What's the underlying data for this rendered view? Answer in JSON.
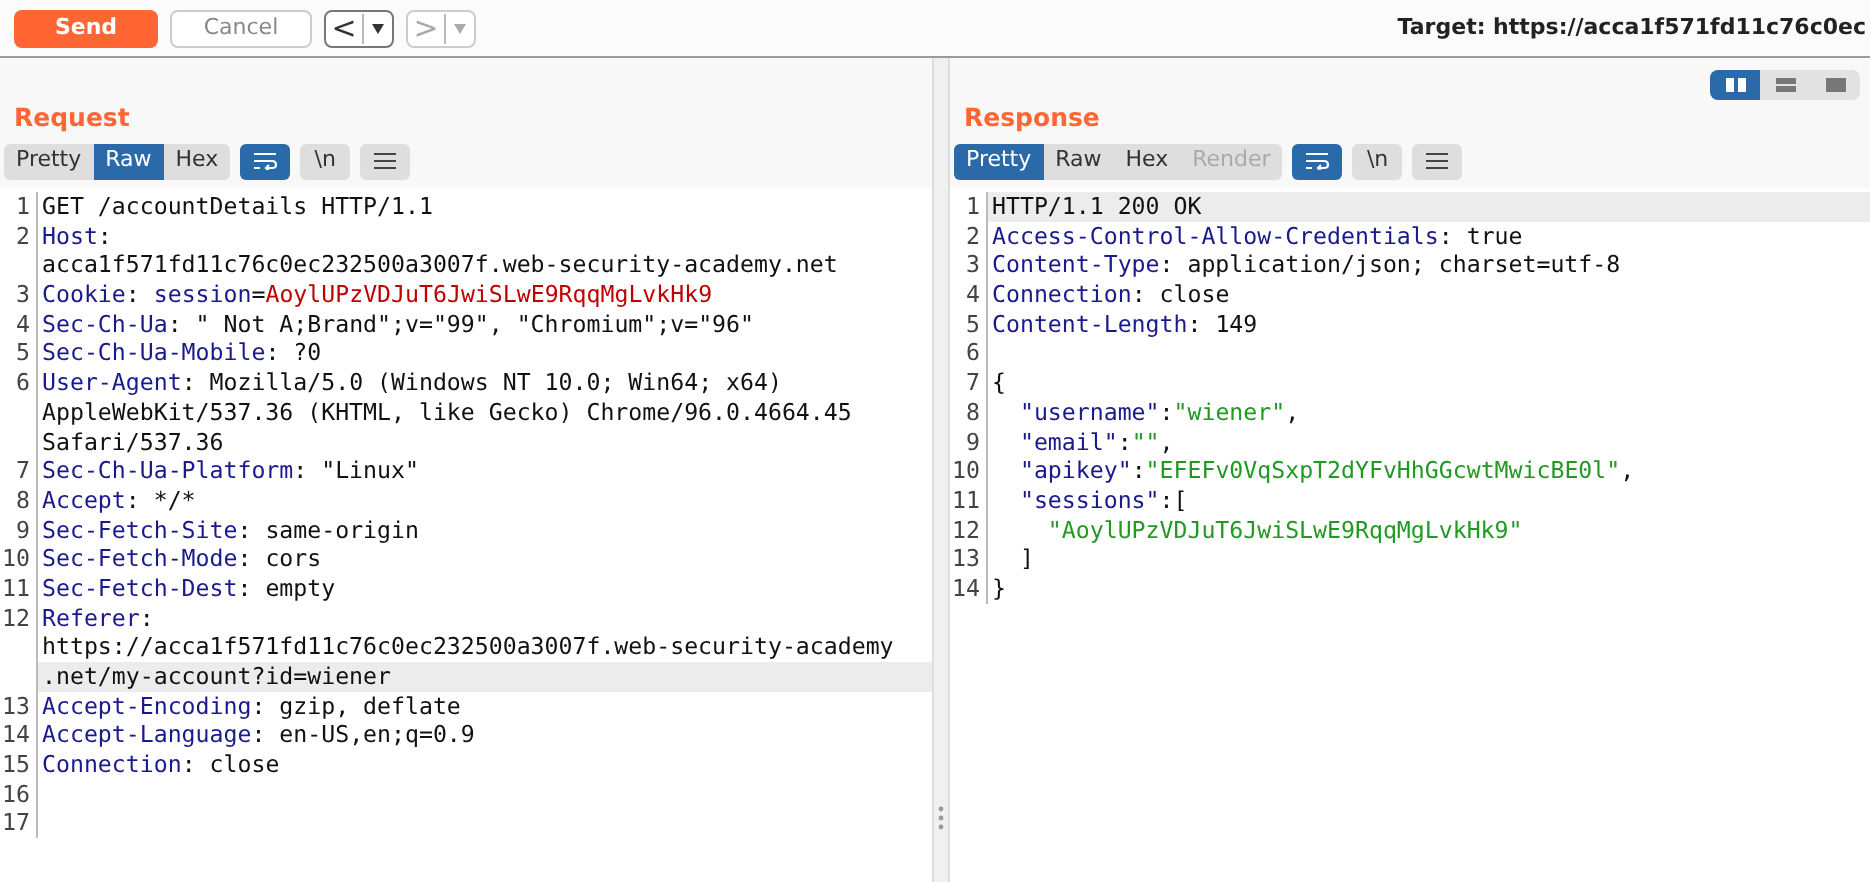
{
  "toolbar": {
    "send": "Send",
    "cancel": "Cancel",
    "back": {
      "label": "<",
      "disabled": false
    },
    "forward": {
      "label": ">",
      "disabled": true
    },
    "target": "Target: https://acca1f571fd11c76c0ec"
  },
  "layout_buttons": [
    {
      "kind": "split",
      "selected": true
    },
    {
      "kind": "stacked",
      "selected": false
    },
    {
      "kind": "single",
      "selected": false
    }
  ],
  "request": {
    "title": "Request",
    "tabs": [
      {
        "label": "Pretty",
        "selected": false,
        "disabled": false
      },
      {
        "label": "Raw",
        "selected": true,
        "disabled": false
      },
      {
        "label": "Hex",
        "selected": false,
        "disabled": false
      }
    ],
    "toggles": [
      {
        "kind": "wrap",
        "on": true
      },
      {
        "kind": "newline",
        "label": "\\n",
        "on": false
      },
      {
        "kind": "menu"
      }
    ],
    "lines": [
      {
        "number": "1",
        "rows": [
          {
            "highlighted": false,
            "segments": [
              {
                "kind": "plain",
                "text": "GET /accountDetails HTTP/1.1"
              }
            ]
          }
        ]
      },
      {
        "number": "2",
        "rows": [
          {
            "highlighted": false,
            "segments": [
              {
                "kind": "name",
                "text": "Host"
              },
              {
                "kind": "plain",
                "text": ":"
              }
            ]
          },
          {
            "highlighted": false,
            "segments": [
              {
                "kind": "plain",
                "text": "acca1f571fd11c76c0ec232500a3007f.web-security-academy.net"
              }
            ]
          }
        ]
      },
      {
        "number": "3",
        "rows": [
          {
            "highlighted": false,
            "segments": [
              {
                "kind": "name",
                "text": "Cookie"
              },
              {
                "kind": "plain",
                "text": ": "
              },
              {
                "kind": "name",
                "text": "session"
              },
              {
                "kind": "plain",
                "text": "="
              },
              {
                "kind": "value",
                "text": "AoylUPzVDJuT6JwiSLwE9RqqMgLvkHk9"
              }
            ]
          }
        ]
      },
      {
        "number": "4",
        "rows": [
          {
            "highlighted": false,
            "segments": [
              {
                "kind": "name",
                "text": "Sec-Ch-Ua"
              },
              {
                "kind": "plain",
                "text": ": \" Not A;Brand\";v=\"99\", \"Chromium\";v=\"96\""
              }
            ]
          }
        ]
      },
      {
        "number": "5",
        "rows": [
          {
            "highlighted": false,
            "segments": [
              {
                "kind": "name",
                "text": "Sec-Ch-Ua-Mobile"
              },
              {
                "kind": "plain",
                "text": ": ?0"
              }
            ]
          }
        ]
      },
      {
        "number": "6",
        "rows": [
          {
            "highlighted": false,
            "segments": [
              {
                "kind": "name",
                "text": "User-Agent"
              },
              {
                "kind": "plain",
                "text": ": Mozilla/5.0 (Windows NT 10.0; Win64; x64)"
              }
            ]
          },
          {
            "highlighted": false,
            "segments": [
              {
                "kind": "plain",
                "text": "AppleWebKit/537.36 (KHTML, like Gecko) Chrome/96.0.4664.45"
              }
            ]
          },
          {
            "highlighted": false,
            "segments": [
              {
                "kind": "plain",
                "text": "Safari/537.36"
              }
            ]
          }
        ]
      },
      {
        "number": "7",
        "rows": [
          {
            "highlighted": false,
            "segments": [
              {
                "kind": "name",
                "text": "Sec-Ch-Ua-Platform"
              },
              {
                "kind": "plain",
                "text": ": \"Linux\""
              }
            ]
          }
        ]
      },
      {
        "number": "8",
        "rows": [
          {
            "highlighted": false,
            "segments": [
              {
                "kind": "name",
                "text": "Accept"
              },
              {
                "kind": "plain",
                "text": ": */*"
              }
            ]
          }
        ]
      },
      {
        "number": "9",
        "rows": [
          {
            "highlighted": false,
            "segments": [
              {
                "kind": "name",
                "text": "Sec-Fetch-Site"
              },
              {
                "kind": "plain",
                "text": ": same-origin"
              }
            ]
          }
        ]
      },
      {
        "number": "10",
        "rows": [
          {
            "highlighted": false,
            "segments": [
              {
                "kind": "name",
                "text": "Sec-Fetch-Mode"
              },
              {
                "kind": "plain",
                "text": ": cors"
              }
            ]
          }
        ]
      },
      {
        "number": "11",
        "rows": [
          {
            "highlighted": false,
            "segments": [
              {
                "kind": "name",
                "text": "Sec-Fetch-Dest"
              },
              {
                "kind": "plain",
                "text": ": empty"
              }
            ]
          }
        ]
      },
      {
        "number": "12",
        "rows": [
          {
            "highlighted": false,
            "segments": [
              {
                "kind": "name",
                "text": "Referer"
              },
              {
                "kind": "plain",
                "text": ":"
              }
            ]
          },
          {
            "highlighted": false,
            "segments": [
              {
                "kind": "plain",
                "text": "https://acca1f571fd11c76c0ec232500a3007f.web-security-academy"
              }
            ]
          },
          {
            "highlighted": true,
            "segments": [
              {
                "kind": "plain",
                "text": ".net/my-account?id=wiener"
              }
            ]
          }
        ]
      },
      {
        "number": "13",
        "rows": [
          {
            "highlighted": false,
            "segments": [
              {
                "kind": "name",
                "text": "Accept-Encoding"
              },
              {
                "kind": "plain",
                "text": ": gzip, deflate"
              }
            ]
          }
        ]
      },
      {
        "number": "14",
        "rows": [
          {
            "highlighted": false,
            "segments": [
              {
                "kind": "name",
                "text": "Accept-Language"
              },
              {
                "kind": "plain",
                "text": ": en-US,en;q=0.9"
              }
            ]
          }
        ]
      },
      {
        "number": "15",
        "rows": [
          {
            "highlighted": false,
            "segments": [
              {
                "kind": "name",
                "text": "Connection"
              },
              {
                "kind": "plain",
                "text": ": close"
              }
            ]
          }
        ]
      },
      {
        "number": "16",
        "rows": [
          {
            "highlighted": false,
            "segments": []
          }
        ]
      },
      {
        "number": "17",
        "rows": [
          {
            "highlighted": false,
            "segments": []
          }
        ]
      }
    ]
  },
  "response": {
    "title": "Response",
    "tabs": [
      {
        "label": "Pretty",
        "selected": true,
        "disabled": false
      },
      {
        "label": "Raw",
        "selected": false,
        "disabled": false
      },
      {
        "label": "Hex",
        "selected": false,
        "disabled": false
      },
      {
        "label": "Render",
        "selected": false,
        "disabled": true
      }
    ],
    "toggles": [
      {
        "kind": "wrap",
        "on": true
      },
      {
        "kind": "newline",
        "label": "\\n",
        "on": false
      },
      {
        "kind": "menu"
      }
    ],
    "lines": [
      {
        "number": "1",
        "rows": [
          {
            "highlighted": true,
            "segments": [
              {
                "kind": "plain",
                "text": "HTTP/1.1 200 OK"
              }
            ]
          }
        ]
      },
      {
        "number": "2",
        "rows": [
          {
            "highlighted": false,
            "segments": [
              {
                "kind": "name",
                "text": "Access-Control-Allow-Credentials"
              },
              {
                "kind": "plain",
                "text": ": true"
              }
            ]
          }
        ]
      },
      {
        "number": "3",
        "rows": [
          {
            "highlighted": false,
            "segments": [
              {
                "kind": "name",
                "text": "Content-Type"
              },
              {
                "kind": "plain",
                "text": ": application/json; charset=utf-8"
              }
            ]
          }
        ]
      },
      {
        "number": "4",
        "rows": [
          {
            "highlighted": false,
            "segments": [
              {
                "kind": "name",
                "text": "Connection"
              },
              {
                "kind": "plain",
                "text": ": close"
              }
            ]
          }
        ]
      },
      {
        "number": "5",
        "rows": [
          {
            "highlighted": false,
            "segments": [
              {
                "kind": "name",
                "text": "Content-Length"
              },
              {
                "kind": "plain",
                "text": ": 149"
              }
            ]
          }
        ]
      },
      {
        "number": "6",
        "rows": [
          {
            "highlighted": false,
            "segments": []
          }
        ]
      },
      {
        "number": "7",
        "rows": [
          {
            "highlighted": false,
            "segments": [
              {
                "kind": "plain",
                "text": "{"
              }
            ]
          }
        ]
      },
      {
        "number": "8",
        "rows": [
          {
            "highlighted": false,
            "segments": [
              {
                "kind": "key",
                "text": "  \"username\""
              },
              {
                "kind": "plain",
                "text": ":"
              },
              {
                "kind": "string",
                "text": "\"wiener\""
              },
              {
                "kind": "plain",
                "text": ","
              }
            ]
          }
        ]
      },
      {
        "number": "9",
        "rows": [
          {
            "highlighted": false,
            "segments": [
              {
                "kind": "key",
                "text": "  \"email\""
              },
              {
                "kind": "plain",
                "text": ":"
              },
              {
                "kind": "string",
                "text": "\"\""
              },
              {
                "kind": "plain",
                "text": ","
              }
            ]
          }
        ]
      },
      {
        "number": "10",
        "rows": [
          {
            "highlighted": false,
            "segments": [
              {
                "kind": "key",
                "text": "  \"apikey\""
              },
              {
                "kind": "plain",
                "text": ":"
              },
              {
                "kind": "string",
                "text": "\"EFEFv0VqSxpT2dYFvHhGGcwtMwicBE0l\""
              },
              {
                "kind": "plain",
                "text": ","
              }
            ]
          }
        ]
      },
      {
        "number": "11",
        "rows": [
          {
            "highlighted": false,
            "segments": [
              {
                "kind": "key",
                "text": "  \"sessions\""
              },
              {
                "kind": "plain",
                "text": ":["
              }
            ]
          }
        ]
      },
      {
        "number": "12",
        "rows": [
          {
            "highlighted": false,
            "segments": [
              {
                "kind": "string",
                "text": "    \"AoylUPzVDJuT6JwiSLwE9RqqMgLvkHk9\""
              }
            ]
          }
        ]
      },
      {
        "number": "13",
        "rows": [
          {
            "highlighted": false,
            "segments": [
              {
                "kind": "plain",
                "text": "  ]"
              }
            ]
          }
        ]
      },
      {
        "number": "14",
        "rows": [
          {
            "highlighted": false,
            "segments": [
              {
                "kind": "plain",
                "text": "}"
              }
            ]
          }
        ]
      }
    ]
  }
}
